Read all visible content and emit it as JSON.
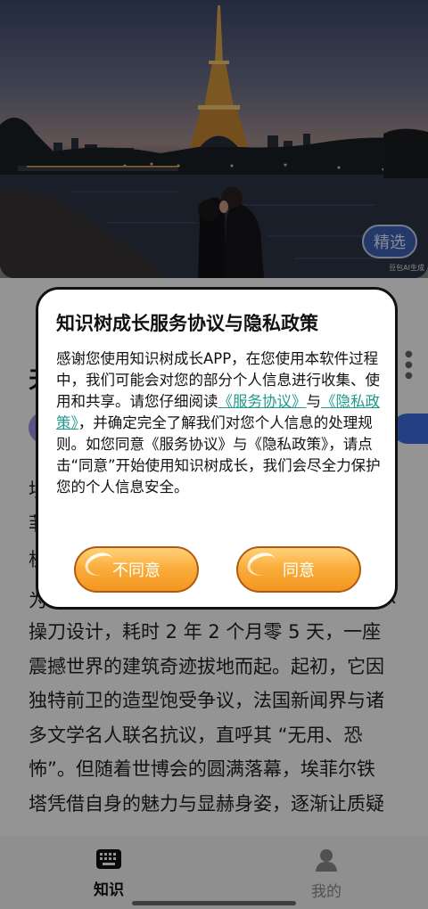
{
  "hero": {
    "pick_label": "精选",
    "ai_tag": "豆包AI生成"
  },
  "article": {
    "title_fragment": "天",
    "fragment_1": "埃",
    "fragment_2": "菲",
    "fragment_3": "杭",
    "fragment_4": "为",
    "fragment_4_end": "X",
    "body_lines": [
      "操刀设计，耗时 2 年 2 个月零 5 天，一座",
      "震撼世界的建筑奇迹拔地而起。起初，它因",
      "独特前卫的造型饱受争议，法国新闻界与诸",
      "多文学名人联名抗议，直呼其 “无用、恐",
      "怖”。但随着世博会的圆满落幕，埃菲尔铁",
      "塔凭借自身的魅力与显赫身姿，逐渐让质疑"
    ]
  },
  "dialog": {
    "title": "知识树成长服务协议与隐私政策",
    "body_part1": "感谢您使用知识树成长APP，在您使用本软件过程中，我们可能会对您的部分个人信息进行收集、使用和共享。请您仔细阅读",
    "link_service": "《服务协议》",
    "and": "与",
    "link_privacy": "《隐私政策》",
    "body_part2": "，并确定完全了解我们对您个人信息的处理规则。如您同意《服务协议》与《隐私政策》，请点击“同意”开始使用知识树成长，我们会尽全力保护您的个人信息安全。",
    "disagree_label": "不同意",
    "agree_label": "同意"
  },
  "nav": {
    "items": [
      {
        "label": "知识",
        "icon": "keyboard-icon",
        "active": true
      },
      {
        "label": "我的",
        "icon": "person-icon",
        "active": false
      }
    ]
  },
  "colors": {
    "link": "#1f9a8a",
    "button": "#f7a12e",
    "accent_blue": "#3d63b5"
  }
}
